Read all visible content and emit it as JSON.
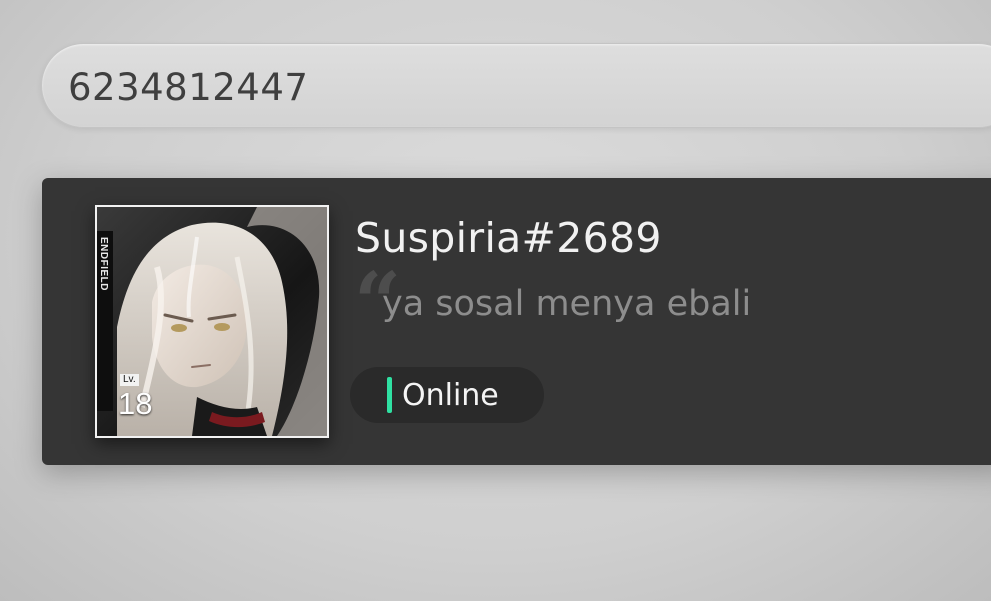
{
  "search": {
    "value": "6234812447"
  },
  "profile_card": {
    "username": "Suspiria#2689",
    "signature": "ya sosal menya ebali",
    "quote_glyph": "“",
    "status": {
      "label": "Online",
      "color": "#2fe0a2"
    },
    "avatar": {
      "brand": "ENDFIELD",
      "level_label": "Lv.",
      "level_value": "18"
    }
  }
}
